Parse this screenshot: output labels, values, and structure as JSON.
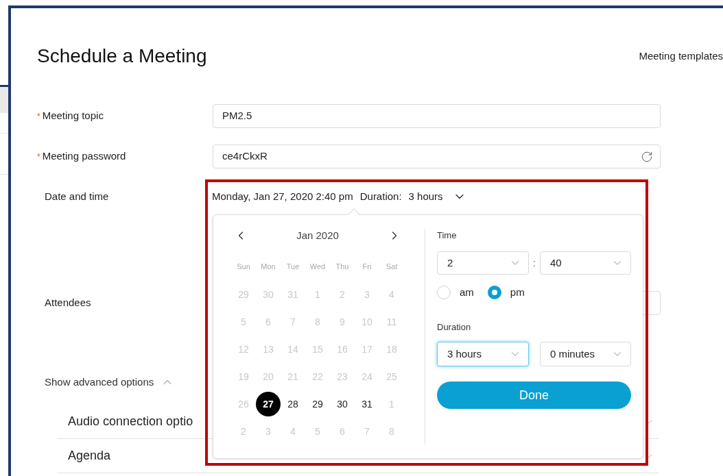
{
  "title": "Schedule a Meeting",
  "templates_link": "Meeting templates",
  "fields": [
    {
      "label": "Meeting topic",
      "required": true,
      "required_mark": "*",
      "value": "PM2.5",
      "kind": "text"
    },
    {
      "label": "Meeting password",
      "required": true,
      "required_mark": "*",
      "value": "ce4rCkxR",
      "kind": "password"
    }
  ],
  "date_time": {
    "label": "Date and time",
    "summary": "Monday, Jan 27, 2020 2:40 pm",
    "duration_label": "Duration:",
    "duration_value": "3 hours",
    "expanded": true
  },
  "attendees": {
    "label": "Attendees"
  },
  "advanced": {
    "label": "Show advanced options",
    "expanded": true,
    "sections": [
      {
        "title": "Audio connection optio"
      },
      {
        "title": "Agenda"
      }
    ]
  },
  "picker": {
    "month": "Jan 2020",
    "weekdays": [
      "Sun",
      "Mon",
      "Tue",
      "Wed",
      "Thu",
      "Fri",
      "Sat"
    ],
    "weeks": [
      {
        "days": [
          {
            "label": "29",
            "disabled": true,
            "selected": false
          },
          {
            "label": "30",
            "disabled": true,
            "selected": false
          },
          {
            "label": "31",
            "disabled": true,
            "selected": false
          },
          {
            "label": "1",
            "disabled": true,
            "selected": false
          },
          {
            "label": "2",
            "disabled": true,
            "selected": false
          },
          {
            "label": "3",
            "disabled": true,
            "selected": false
          },
          {
            "label": "4",
            "disabled": true,
            "selected": false
          }
        ]
      },
      {
        "days": [
          {
            "label": "5",
            "disabled": true,
            "selected": false
          },
          {
            "label": "6",
            "disabled": true,
            "selected": false
          },
          {
            "label": "7",
            "disabled": true,
            "selected": false
          },
          {
            "label": "8",
            "disabled": true,
            "selected": false
          },
          {
            "label": "9",
            "disabled": true,
            "selected": false
          },
          {
            "label": "10",
            "disabled": true,
            "selected": false
          },
          {
            "label": "11",
            "disabled": true,
            "selected": false
          }
        ]
      },
      {
        "days": [
          {
            "label": "12",
            "disabled": true,
            "selected": false
          },
          {
            "label": "13",
            "disabled": true,
            "selected": false
          },
          {
            "label": "14",
            "disabled": true,
            "selected": false
          },
          {
            "label": "15",
            "disabled": true,
            "selected": false
          },
          {
            "label": "16",
            "disabled": true,
            "selected": false
          },
          {
            "label": "17",
            "disabled": true,
            "selected": false
          },
          {
            "label": "18",
            "disabled": true,
            "selected": false
          }
        ]
      },
      {
        "days": [
          {
            "label": "19",
            "disabled": true,
            "selected": false
          },
          {
            "label": "20",
            "disabled": true,
            "selected": false
          },
          {
            "label": "21",
            "disabled": true,
            "selected": false
          },
          {
            "label": "22",
            "disabled": true,
            "selected": false
          },
          {
            "label": "23",
            "disabled": true,
            "selected": false
          },
          {
            "label": "24",
            "disabled": true,
            "selected": false
          },
          {
            "label": "25",
            "disabled": true,
            "selected": false
          }
        ]
      },
      {
        "days": [
          {
            "label": "26",
            "disabled": true,
            "selected": false
          },
          {
            "label": "27",
            "disabled": false,
            "selected": true
          },
          {
            "label": "28",
            "disabled": false,
            "selected": false
          },
          {
            "label": "29",
            "disabled": false,
            "selected": false
          },
          {
            "label": "30",
            "disabled": false,
            "selected": false
          },
          {
            "label": "31",
            "disabled": false,
            "selected": false
          },
          {
            "label": "1",
            "disabled": true,
            "selected": false
          }
        ]
      },
      {
        "days": [
          {
            "label": "2",
            "disabled": true,
            "selected": false
          },
          {
            "label": "3",
            "disabled": true,
            "selected": false
          },
          {
            "label": "4",
            "disabled": true,
            "selected": false
          },
          {
            "label": "5",
            "disabled": true,
            "selected": false
          },
          {
            "label": "6",
            "disabled": true,
            "selected": false
          },
          {
            "label": "7",
            "disabled": true,
            "selected": false
          },
          {
            "label": "8",
            "disabled": true,
            "selected": false
          }
        ]
      }
    ]
  },
  "time": {
    "label": "Time",
    "hour": "2",
    "separator": ":",
    "minute": "40",
    "periods": [
      {
        "label": "am",
        "selected": false
      },
      {
        "label": "pm",
        "selected": true
      }
    ]
  },
  "duration": {
    "label": "Duration",
    "hours": "3 hours",
    "hours_focused": true,
    "minutes": "0 minutes"
  },
  "done": "Done"
}
